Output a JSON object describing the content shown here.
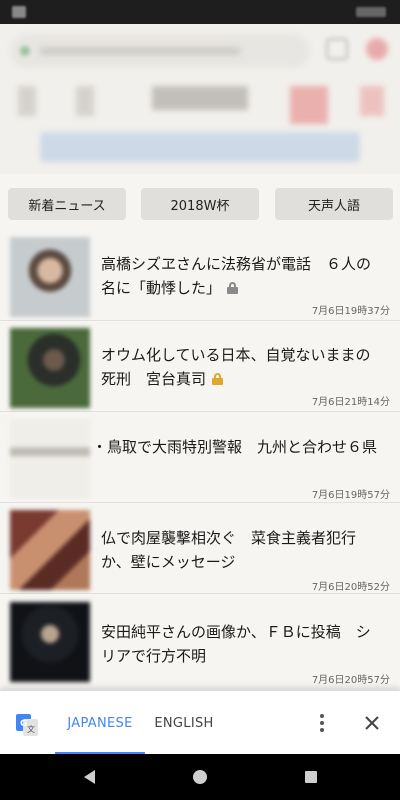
{
  "categories": [
    "新着ニュース",
    "2018W杯",
    "天声人語"
  ],
  "articles": [
    {
      "title_l1": "高橋シズヱさんに法務省が電話　６人の",
      "title_l2": "名に「動悸した」",
      "lock": "gray",
      "date": "7月6日19時37分",
      "thumb": "portrait-photo"
    },
    {
      "title_l1": "オウム化している日本、自覚ないままの",
      "title_l2": "死刑　宮台真司",
      "lock": "gold",
      "date": "7月6日21時14分",
      "thumb": "person-photo"
    },
    {
      "title_l1": "鳥取で大雨特別警報　九州と合わせ６県",
      "date": "7月6日19時57分",
      "thumb": "text-graphic"
    },
    {
      "title_l1": "仏で肉屋襲撃相次ぐ　菜食主義者犯行",
      "title_l2": "か、壁にメッセージ",
      "date": "7月6日20時52分",
      "thumb": "shop-photo"
    },
    {
      "title_l1": "安田純平さんの画像か、ＦＢに投稿　シ",
      "title_l2": "リアで行方不明",
      "date": "7月6日20時57分",
      "thumb": "dark-portrait-photo"
    }
  ],
  "translate_bar": {
    "tab_japanese": "JAPANESE",
    "tab_english": "ENGLISH",
    "accent_color": "#4285f4",
    "icons": [
      "google-translate-icon",
      "more-vert-icon",
      "close-icon"
    ]
  },
  "navbar": {
    "icons": [
      "back-icon",
      "home-icon",
      "recents-icon"
    ]
  }
}
